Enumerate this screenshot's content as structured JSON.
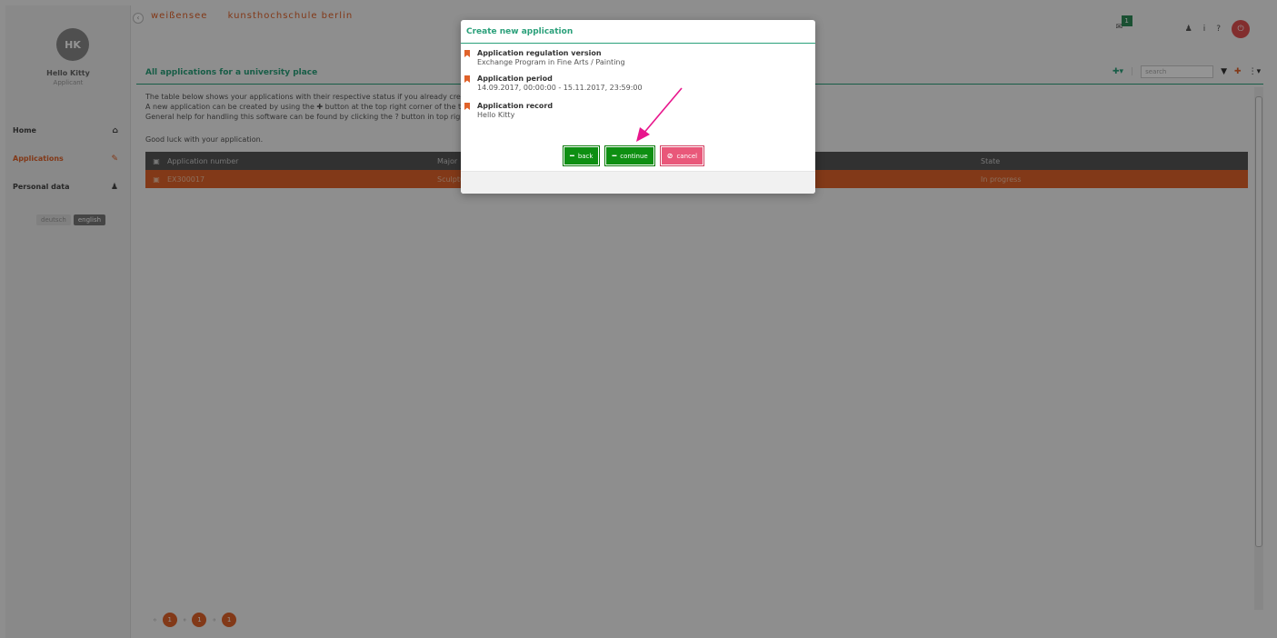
{
  "user": {
    "initials": "HK",
    "name": "Hello Kitty",
    "role": "Applicant"
  },
  "nav": [
    {
      "label": "Home",
      "icon": "home-icon",
      "glyph": "⌂"
    },
    {
      "label": "Applications",
      "icon": "pencil-icon",
      "glyph": "✎"
    },
    {
      "label": "Personal data",
      "icon": "person-icon",
      "glyph": "♟"
    }
  ],
  "languages": {
    "german": "deutsch",
    "english": "english"
  },
  "header": {
    "brand_1": "weißensee",
    "brand_2": "kunsthochschule berlin",
    "message_count": "1"
  },
  "panel": {
    "title": "All applications for a university place",
    "search_placeholder": "search",
    "intro_lines": [
      "The table below shows your applications with their respective status if you already created",
      "A new application can be created by using the ✚ button at the top right corner of the table",
      "General help for handling this software can be found by clicking the ? button in top right"
    ],
    "good_luck": "Good luck with your application.",
    "columns": {
      "app_number": "Application number",
      "major": "Major",
      "state": "State"
    },
    "row": {
      "app_number": "EX300017",
      "major": "Sculpture",
      "state": "In progress"
    }
  },
  "pagination": [
    "1",
    "1",
    "1"
  ],
  "modal": {
    "title": "Create new application",
    "items": [
      {
        "label": "Application regulation version",
        "value": "Exchange Program in Fine Arts / Painting"
      },
      {
        "label": "Application period",
        "value": "14.09.2017, 00:00:00 - 15.11.2017, 23:59:00"
      },
      {
        "label": "Application record",
        "value": "Hello Kitty"
      }
    ],
    "back": "back",
    "continue": "continue",
    "cancel": "cancel"
  },
  "colors": {
    "accent_orange": "#e0622a",
    "accent_green": "#2aa07a",
    "button_green": "#0e8f12",
    "button_red": "#e9587a",
    "arrow": "#e8168c"
  }
}
